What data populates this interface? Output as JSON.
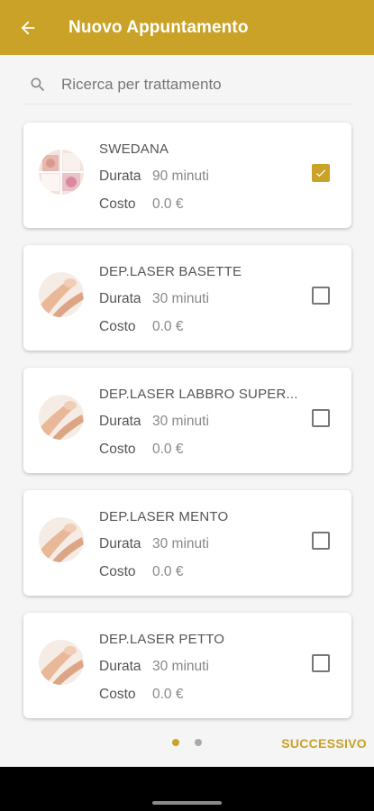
{
  "header": {
    "title": "Nuovo Appuntamento"
  },
  "search": {
    "placeholder": "Ricerca per trattamento",
    "value": ""
  },
  "colors": {
    "accent": "#c9a227"
  },
  "items": [
    {
      "name": "SWEDANA",
      "durata_label": "Durata",
      "durata": "90 minuti",
      "costo_label": "Costo",
      "costo": "0.0 €",
      "checked": true,
      "thumb_icon": "massage-photo"
    },
    {
      "name": "DEP.LASER BASETTE",
      "durata_label": "Durata",
      "durata": "30 minuti",
      "costo_label": "Costo",
      "costo": "0.0 €",
      "checked": false,
      "thumb_icon": "laser-photo"
    },
    {
      "name": "DEP.LASER LABBRO SUPER...",
      "durata_label": "Durata",
      "durata": "30 minuti",
      "costo_label": "Costo",
      "costo": "0.0 €",
      "checked": false,
      "thumb_icon": "laser-photo"
    },
    {
      "name": "DEP.LASER MENTO",
      "durata_label": "Durata",
      "durata": "30 minuti",
      "costo_label": "Costo",
      "costo": "0.0 €",
      "checked": false,
      "thumb_icon": "laser-photo"
    },
    {
      "name": "DEP.LASER PETTO",
      "durata_label": "Durata",
      "durata": "30 minuti",
      "costo_label": "Costo",
      "costo": "0.0 €",
      "checked": false,
      "thumb_icon": "laser-photo"
    }
  ],
  "pager": {
    "pages": 2,
    "current": 1
  },
  "footer": {
    "next_label": "SUCCESSIVO"
  }
}
